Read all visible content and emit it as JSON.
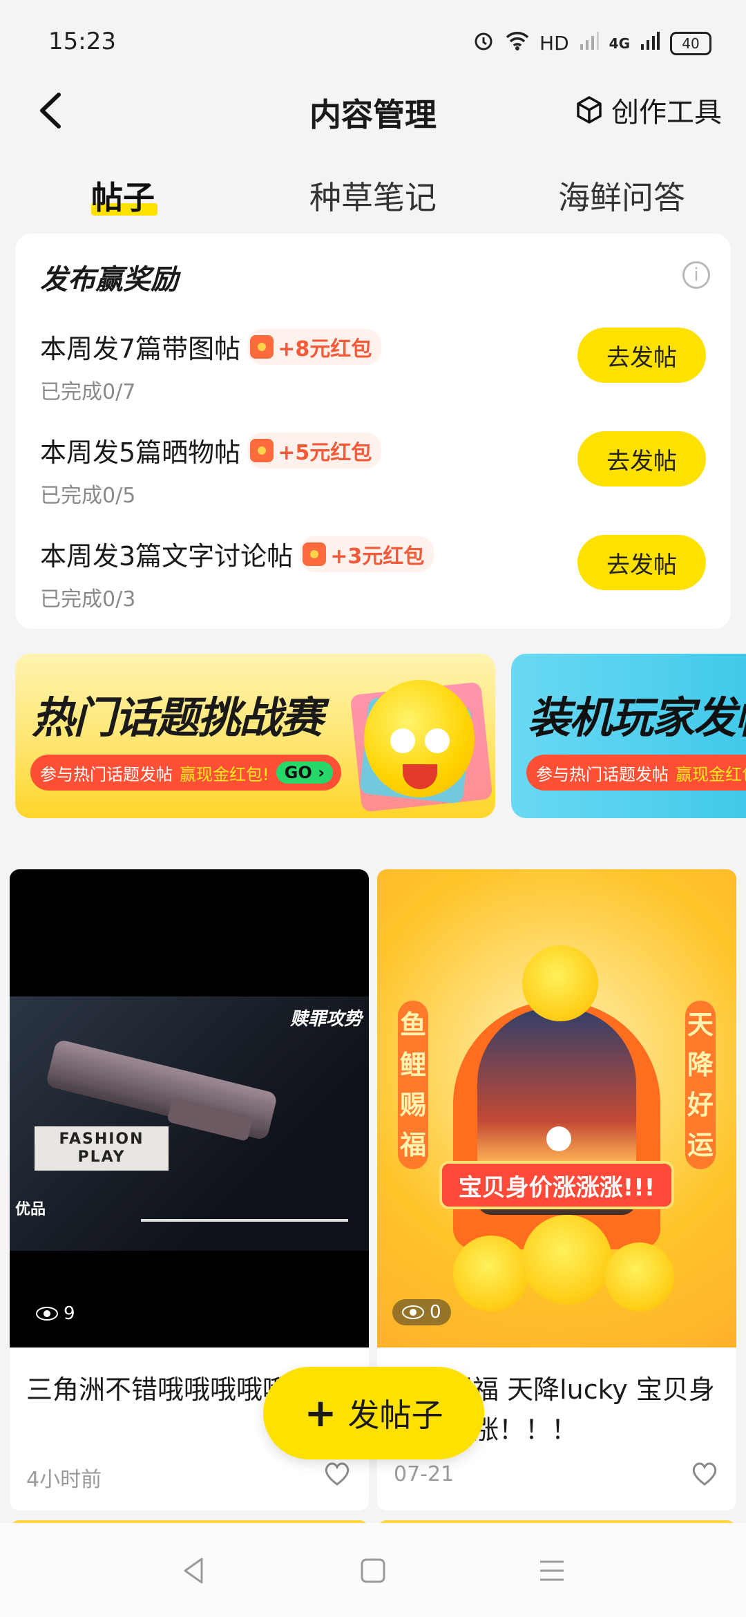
{
  "status_bar": {
    "time": "15:23",
    "network_label": "HD",
    "network_type": "4G",
    "battery": "40"
  },
  "header": {
    "title": "内容管理",
    "tool_label": "创作工具"
  },
  "tabs": [
    {
      "label": "帖子",
      "active": true
    },
    {
      "label": "种草笔记",
      "active": false
    },
    {
      "label": "海鲜问答",
      "active": false
    }
  ],
  "rewards": {
    "title": "发布赢奖励",
    "tasks": [
      {
        "label": "本周发7篇带图帖",
        "reward": "+8元红包",
        "progress": "已完成0/7",
        "button": "去发帖"
      },
      {
        "label": "本周发5篇晒物帖",
        "reward": "+5元红包",
        "progress": "已完成0/5",
        "button": "去发帖"
      },
      {
        "label": "本周发3篇文字讨论帖",
        "reward": "+3元红包",
        "progress": "已完成0/3",
        "button": "去发帖"
      }
    ]
  },
  "banners": [
    {
      "title": "热门话题挑战赛",
      "pill_text": "参与热门话题发帖",
      "pill_highlight": "赢现金红包!",
      "go_label": "GO ›"
    },
    {
      "title": "装机玩家发帖",
      "pill_text": "参与热门话题发帖",
      "pill_highlight": "赢现金红包!"
    }
  ],
  "posts": [
    {
      "views": "9",
      "title": "三角洲不错哦哦哦哦哦哦！",
      "time": "4小时前",
      "image_texts": {
        "badge": "FASHION PLAY",
        "game_label": "优品",
        "corner_title": "赎罪攻势"
      }
    },
    {
      "views": "0",
      "title": "鱼鲤赐福 天降lucky 宝贝身价涨涨涨！！！",
      "time": "07-21",
      "image_texts": {
        "left_couplet": "鱼鲤赐福",
        "right_couplet": "天降好运",
        "banner": "宝贝身价涨涨涨!!!"
      }
    }
  ],
  "fab": {
    "label": "发帖子",
    "icon": "plus-icon"
  },
  "colors": {
    "accent": "#ffe100",
    "red_packet": "#f35a3a"
  }
}
